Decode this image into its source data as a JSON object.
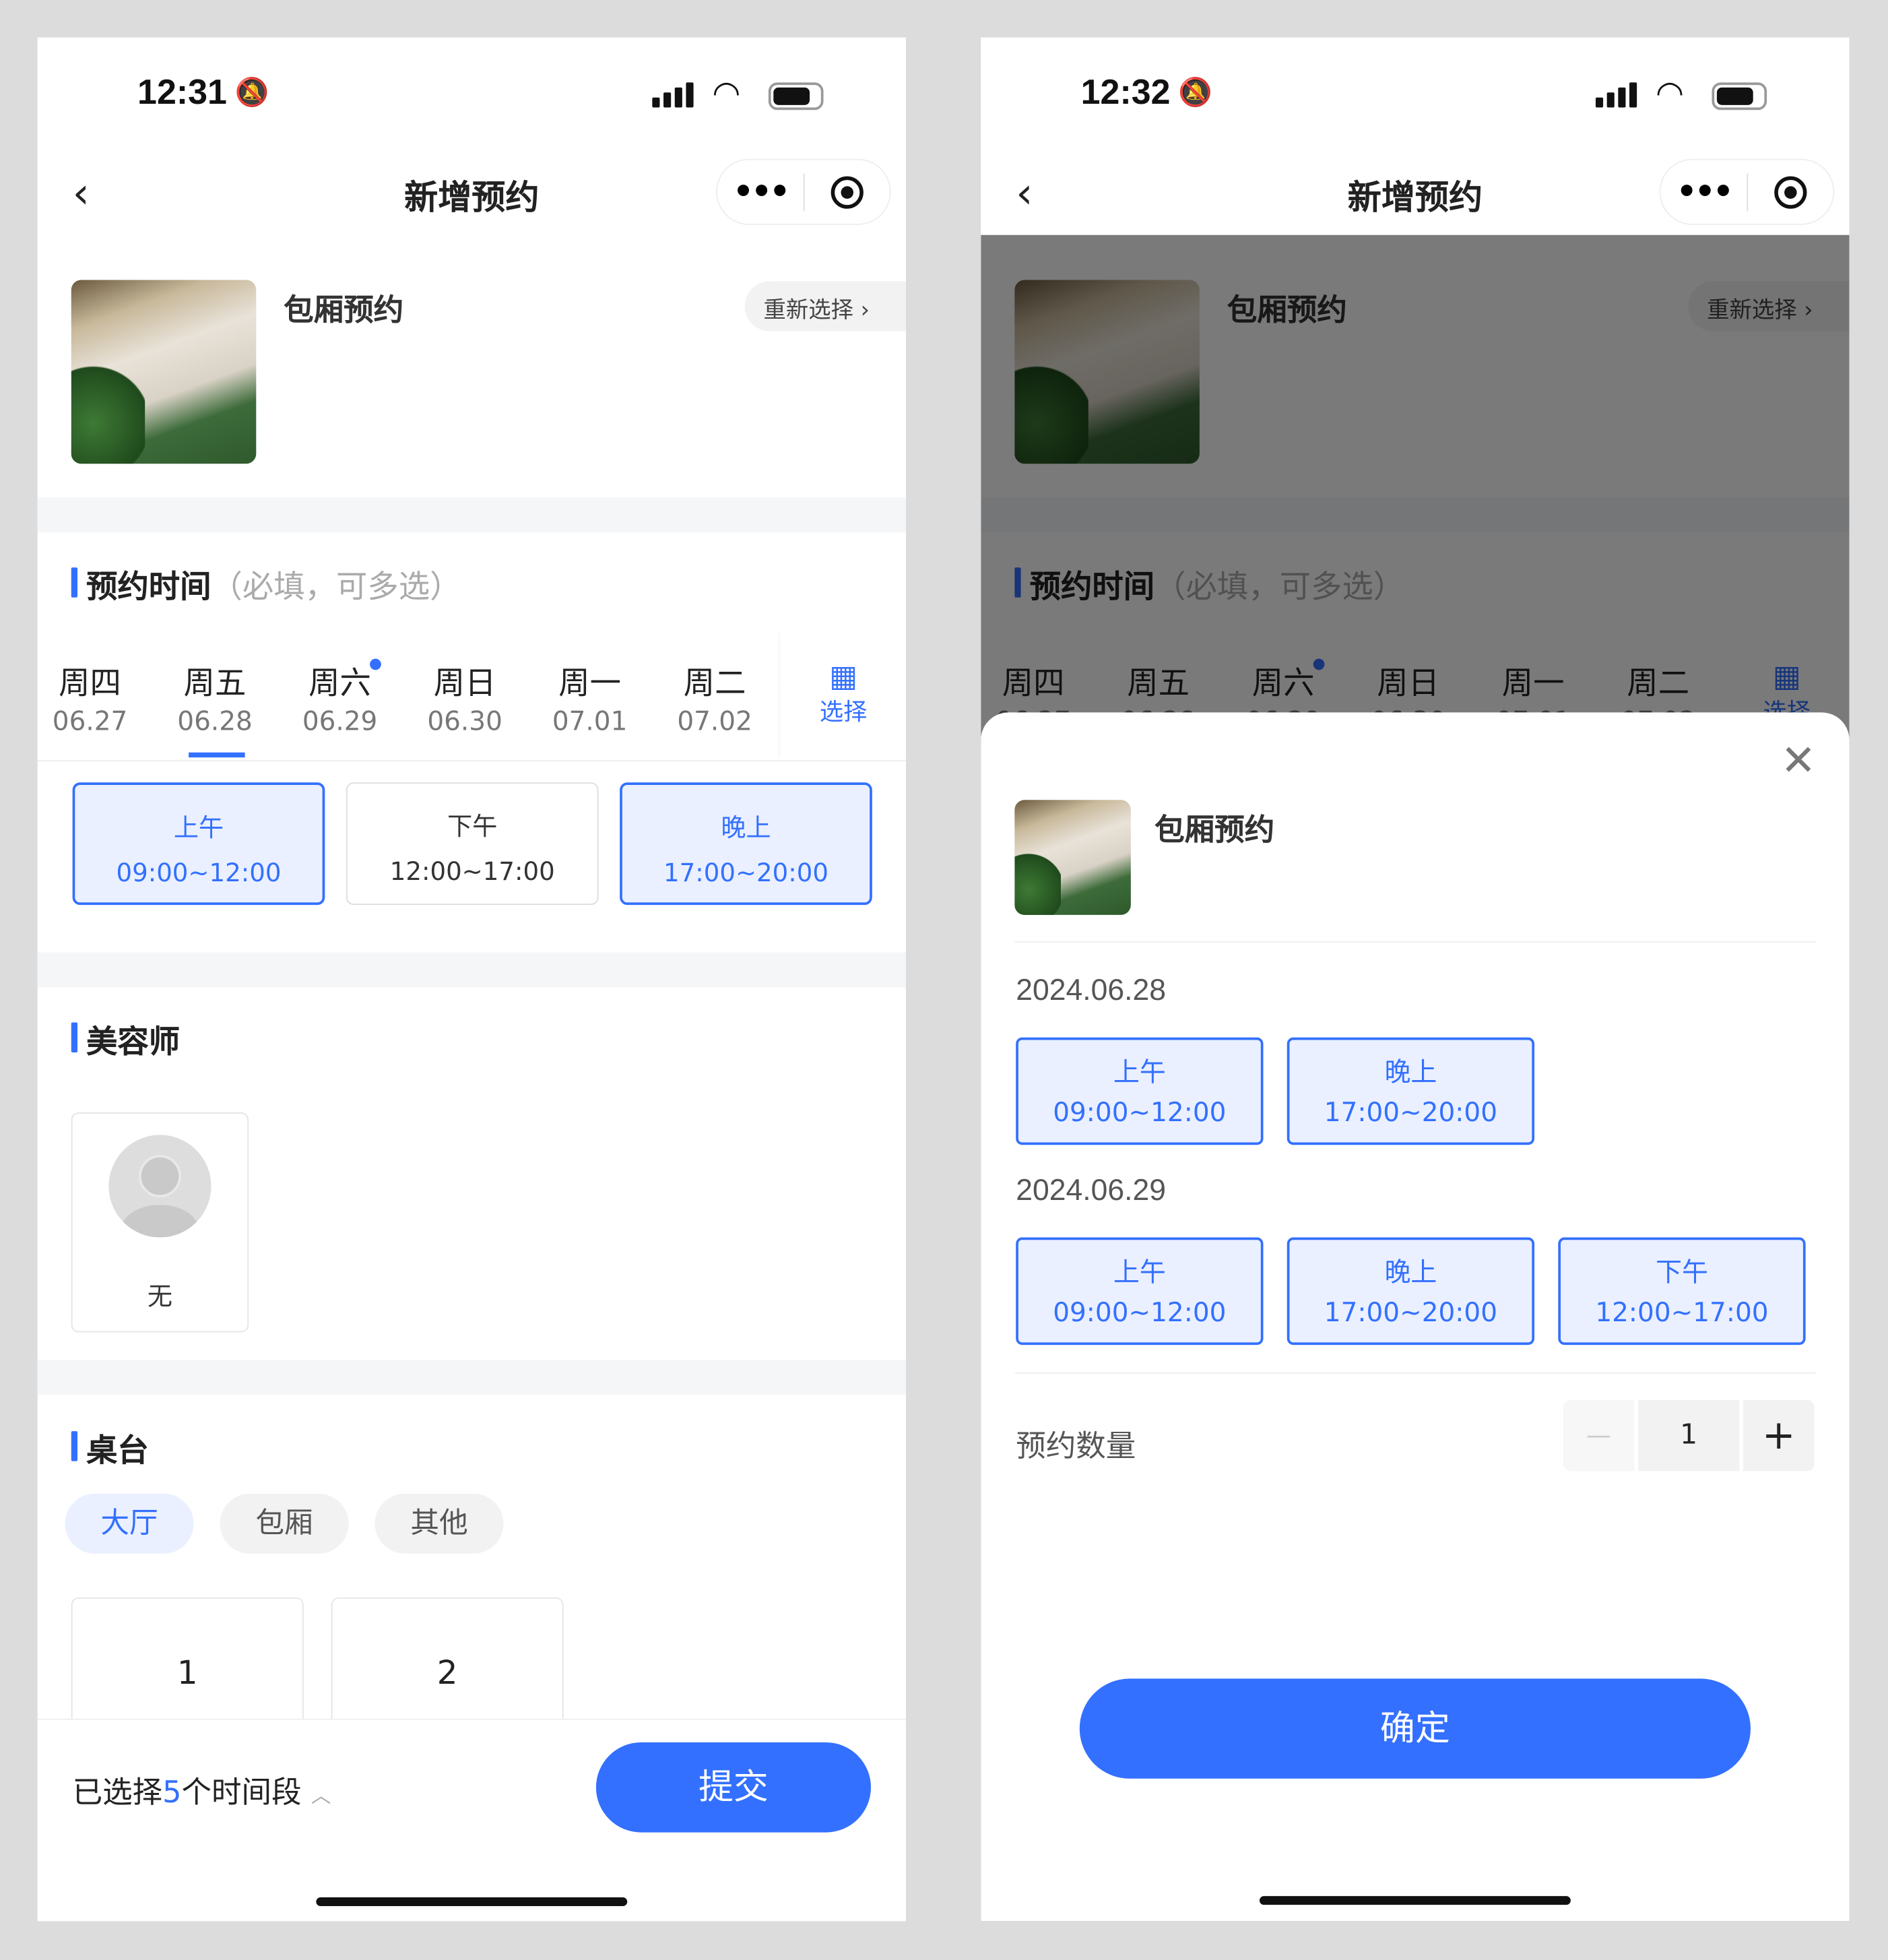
{
  "left": {
    "status": {
      "time": "12:31"
    },
    "nav": {
      "title": "新增预约",
      "more": "•••"
    },
    "product": {
      "title": "包厢预约",
      "reselect": "重新选择"
    },
    "booking": {
      "title": "预约时间",
      "hint": "（必填，可多选）",
      "days": [
        {
          "week": "周四",
          "date": "06.27"
        },
        {
          "week": "周五",
          "date": "06.28",
          "active": true
        },
        {
          "week": "周六",
          "date": "06.29",
          "dot": true
        },
        {
          "week": "周日",
          "date": "06.30"
        },
        {
          "week": "周一",
          "date": "07.01"
        },
        {
          "week": "周二",
          "date": "07.02"
        }
      ],
      "calendar_label": "选择",
      "slots": [
        {
          "name": "上午",
          "time": "09:00~12:00",
          "selected": true
        },
        {
          "name": "下午",
          "time": "12:00~17:00",
          "selected": false
        },
        {
          "name": "晚上",
          "time": "17:00~20:00",
          "selected": true
        }
      ]
    },
    "beautician": {
      "title": "美容师",
      "items": [
        {
          "name": "无"
        }
      ]
    },
    "table": {
      "title": "桌台",
      "chips": [
        {
          "label": "大厅",
          "active": true
        },
        {
          "label": "包厢"
        },
        {
          "label": "其他"
        }
      ],
      "items": [
        "1",
        "2"
      ]
    },
    "footer": {
      "prefix": "已选择",
      "count": "5",
      "suffix": "个时间段",
      "submit": "提交"
    }
  },
  "right": {
    "status": {
      "time": "12:32"
    },
    "sheet": {
      "title": "包厢预约",
      "groups": [
        {
          "date": "2024.06.28",
          "slots": [
            {
              "name": "上午",
              "time": "09:00~12:00"
            },
            {
              "name": "晚上",
              "time": "17:00~20:00"
            }
          ]
        },
        {
          "date": "2024.06.29",
          "slots": [
            {
              "name": "上午",
              "time": "09:00~12:00"
            },
            {
              "name": "晚上",
              "time": "17:00~20:00"
            },
            {
              "name": "下午",
              "time": "12:00~17:00"
            }
          ]
        }
      ],
      "quantity_label": "预约数量",
      "quantity": "1",
      "minus": "—",
      "plus": "+",
      "confirm": "确定"
    }
  },
  "colors": {
    "accent": "#3370ff",
    "selected_bg": "#eaf0ff",
    "background": "#dcdcdc"
  }
}
